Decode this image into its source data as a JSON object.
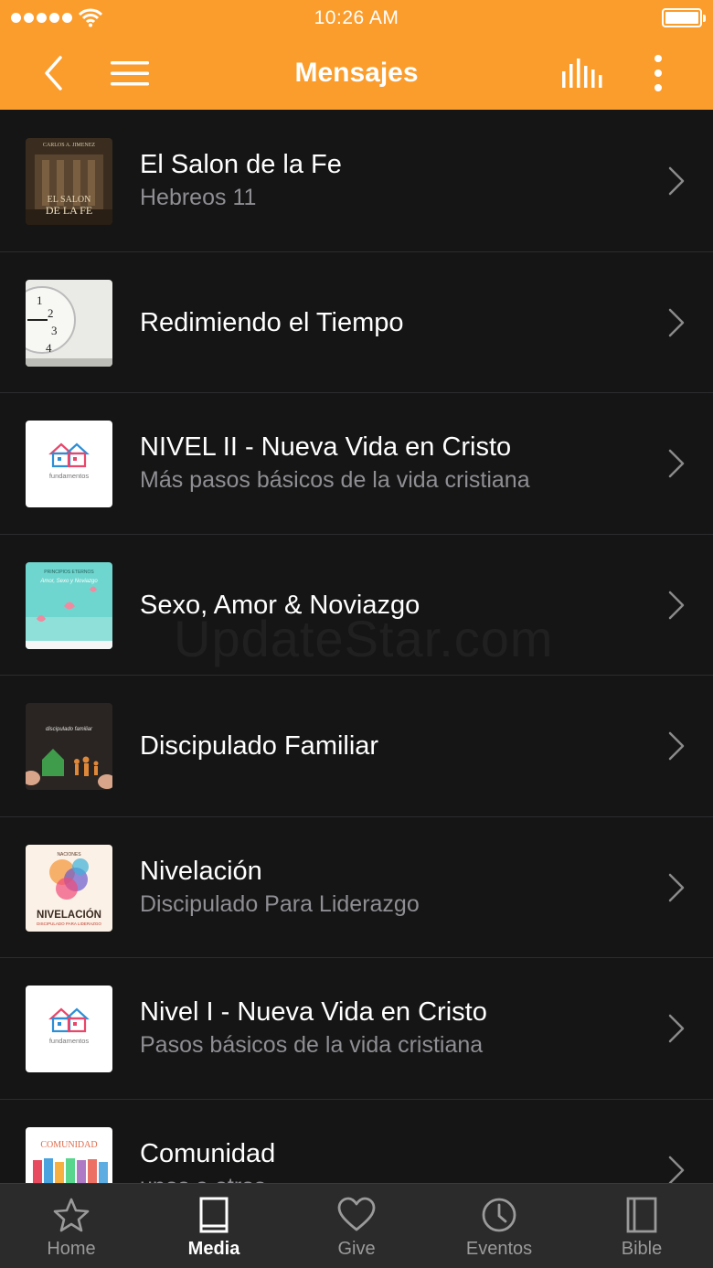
{
  "status_bar": {
    "time": "10:26 AM"
  },
  "header": {
    "title": "Mensajes"
  },
  "items": [
    {
      "title": "El Salon de la Fe",
      "subtitle": "Hebreos 11",
      "thumb": {
        "author": "CARLOS A. JIMENEZ",
        "line1": "EL SALON",
        "line2": "DE LA FE"
      }
    },
    {
      "title": "Redimiendo el Tiempo",
      "subtitle": ""
    },
    {
      "title": "NIVEL II - Nueva Vida en Cristo",
      "subtitle": "Más pasos básicos de la vida cristiana",
      "thumb": {
        "caption": "fundamentos"
      }
    },
    {
      "title": "Sexo, Amor & Noviazgo",
      "subtitle": "",
      "thumb": {
        "line1": "PRINCIPIOS ETERNOS",
        "line2": "Amor, Sexo y Noviazgo"
      }
    },
    {
      "title": "Discipulado Familiar",
      "subtitle": "",
      "thumb": {
        "line1": "discipulado familiar"
      }
    },
    {
      "title": "Nivelación",
      "subtitle": "Discipulado Para Liderazgo",
      "thumb": {
        "line1": "NIVELACIÓN",
        "line2": "DISCIPULADO PARA LIDERAZGO",
        "top": "NACIONES"
      }
    },
    {
      "title": "Nivel I - Nueva Vida en Cristo",
      "subtitle": "Pasos básicos de la vida cristiana",
      "thumb": {
        "caption": "fundamentos"
      }
    },
    {
      "title": "Comunidad",
      "subtitle": "unos a otros",
      "thumb": {
        "line1": "COMUNIDAD"
      }
    }
  ],
  "watermark": "UpdateStar.com",
  "tabs": [
    {
      "label": "Home",
      "icon": "star-icon"
    },
    {
      "label": "Media",
      "icon": "book-icon",
      "active": true
    },
    {
      "label": "Give",
      "icon": "heart-icon"
    },
    {
      "label": "Eventos",
      "icon": "clock-icon"
    },
    {
      "label": "Bible",
      "icon": "bible-icon"
    }
  ],
  "colors": {
    "accent": "#fb9d2c",
    "background": "#151515",
    "tab_bar": "#2b2b2b",
    "subtitle": "#8e8e93"
  }
}
